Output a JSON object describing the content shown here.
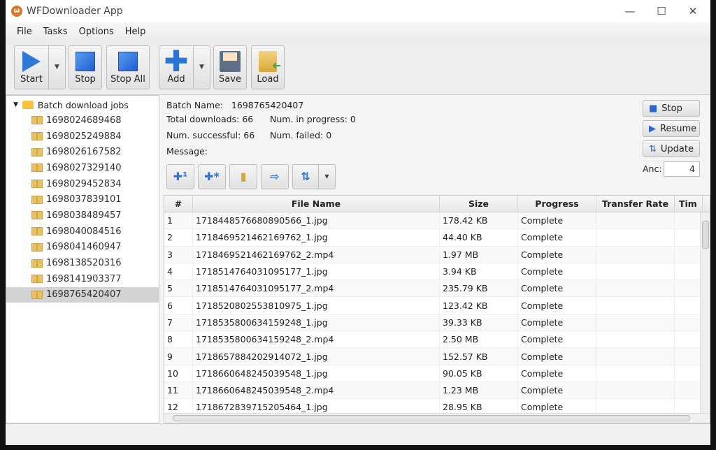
{
  "window": {
    "title": "WFDownloader App",
    "minimize": "—",
    "maximize": "☐",
    "close": "✕"
  },
  "menu": [
    "File",
    "Tasks",
    "Options",
    "Help"
  ],
  "toolbar": {
    "start": "Start",
    "stop": "Stop",
    "stop_all": "Stop All",
    "add": "Add",
    "save": "Save",
    "load": "Load"
  },
  "tree": {
    "root": "Batch download jobs",
    "items": [
      "1698024689468",
      "1698025249884",
      "1698026167582",
      "1698027329140",
      "1698029452834",
      "1698037839101",
      "1698038489457",
      "1698040084516",
      "1698041460947",
      "1698138520316",
      "1698141903377",
      "1698765420407"
    ],
    "selected": "1698765420407"
  },
  "batch": {
    "name_label": "Batch Name:",
    "name": "1698765420407",
    "total_label": "Total downloads:",
    "total": "66",
    "in_progress_label": "Num. in progress:",
    "in_progress": "0",
    "successful_label": "Num. successful:",
    "successful": "66",
    "failed_label": "Num. failed:",
    "failed": "0",
    "message_label": "Message:"
  },
  "side_buttons": {
    "stop": "Stop",
    "resume": "Resume",
    "update": "Update",
    "anc_label": "Anc:",
    "anc_value": "4"
  },
  "table": {
    "headers": [
      "#",
      "File Name",
      "Size",
      "Progress",
      "Transfer Rate",
      "Tim"
    ],
    "rows": [
      [
        "1",
        "1718448576680890566_1.jpg",
        "178.42 KB",
        "Complete"
      ],
      [
        "2",
        "1718469521462169762_1.jpg",
        "44.40 KB",
        "Complete"
      ],
      [
        "3",
        "1718469521462169762_2.mp4",
        "1.97 MB",
        "Complete"
      ],
      [
        "4",
        "1718514764031095177_1.jpg",
        "3.94 KB",
        "Complete"
      ],
      [
        "5",
        "1718514764031095177_2.mp4",
        "235.79 KB",
        "Complete"
      ],
      [
        "6",
        "1718520802553810975_1.jpg",
        "123.42 KB",
        "Complete"
      ],
      [
        "7",
        "1718535800634159248_1.jpg",
        "39.33 KB",
        "Complete"
      ],
      [
        "8",
        "1718535800634159248_2.mp4",
        "2.50 MB",
        "Complete"
      ],
      [
        "9",
        "1718657884202914072_1.jpg",
        "152.57 KB",
        "Complete"
      ],
      [
        "10",
        "1718660648245039548_1.jpg",
        "90.05 KB",
        "Complete"
      ],
      [
        "11",
        "1718660648245039548_2.mp4",
        "1.23 MB",
        "Complete"
      ],
      [
        "12",
        "1718672839715205464_1.jpg",
        "28.95 KB",
        "Complete"
      ]
    ]
  }
}
